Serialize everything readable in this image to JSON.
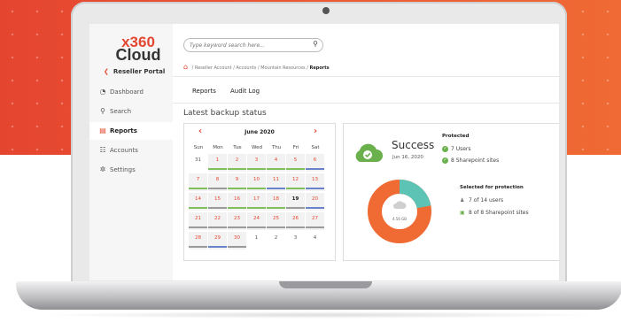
{
  "colors": {
    "accent": "#e4472f",
    "success": "#6ab04c",
    "donut_teal": "#5cc3b5",
    "donut_orange": "#f06a33"
  },
  "logo": {
    "line1": "x360",
    "line2": "Cloud"
  },
  "sidebar": {
    "back_label": "Reseller Portal",
    "back_icon": "chevron-left-icon",
    "items": [
      {
        "label": "Dashboard",
        "icon": "gauge-icon",
        "active": false
      },
      {
        "label": "Search",
        "icon": "search-icon",
        "active": false
      },
      {
        "label": "Reports",
        "icon": "report-icon",
        "active": true
      },
      {
        "label": "Accounts",
        "icon": "users-icon",
        "active": false
      },
      {
        "label": "Settings",
        "icon": "gear-icon",
        "active": false
      }
    ]
  },
  "search": {
    "placeholder": "Type keyword search here...",
    "icon": "search-icon"
  },
  "breadcrumb": {
    "home_icon": "home-icon",
    "items": [
      "Reseller Account",
      "Accounts",
      "Mountain Resources",
      "Reports"
    ],
    "separator": "/"
  },
  "tabs": [
    "Reports",
    "Audit Log"
  ],
  "section_title": "Latest backup status",
  "calendar": {
    "month_label": "June 2020",
    "weekdays": [
      "Sun",
      "Mon",
      "Tue",
      "Wed",
      "Thu",
      "Fri",
      "Sat"
    ],
    "weeks": [
      [
        "31",
        "1",
        "2",
        "3",
        "4",
        "5",
        "6"
      ],
      [
        "7",
        "8",
        "9",
        "10",
        "11",
        "12",
        "13"
      ],
      [
        "14",
        "15",
        "16",
        "17",
        "18",
        "19",
        "20"
      ],
      [
        "21",
        "22",
        "23",
        "24",
        "25",
        "26",
        "27"
      ],
      [
        "28",
        "29",
        "30",
        "1",
        "2",
        "3",
        "4"
      ]
    ],
    "today": "19"
  },
  "status": {
    "headline": "Success",
    "date": "Jun 16, 2020",
    "protected_label": "Protected",
    "protected_users": "7 Users",
    "protected_sites": "8 Sharepoint sites",
    "selected_label": "Selected for protection",
    "selected_users": "7 of 14 users",
    "selected_sites": "8 of 8 Sharepoint sites",
    "donut_label": "4.56 GB",
    "donut_fraction_teal": 0.22
  }
}
